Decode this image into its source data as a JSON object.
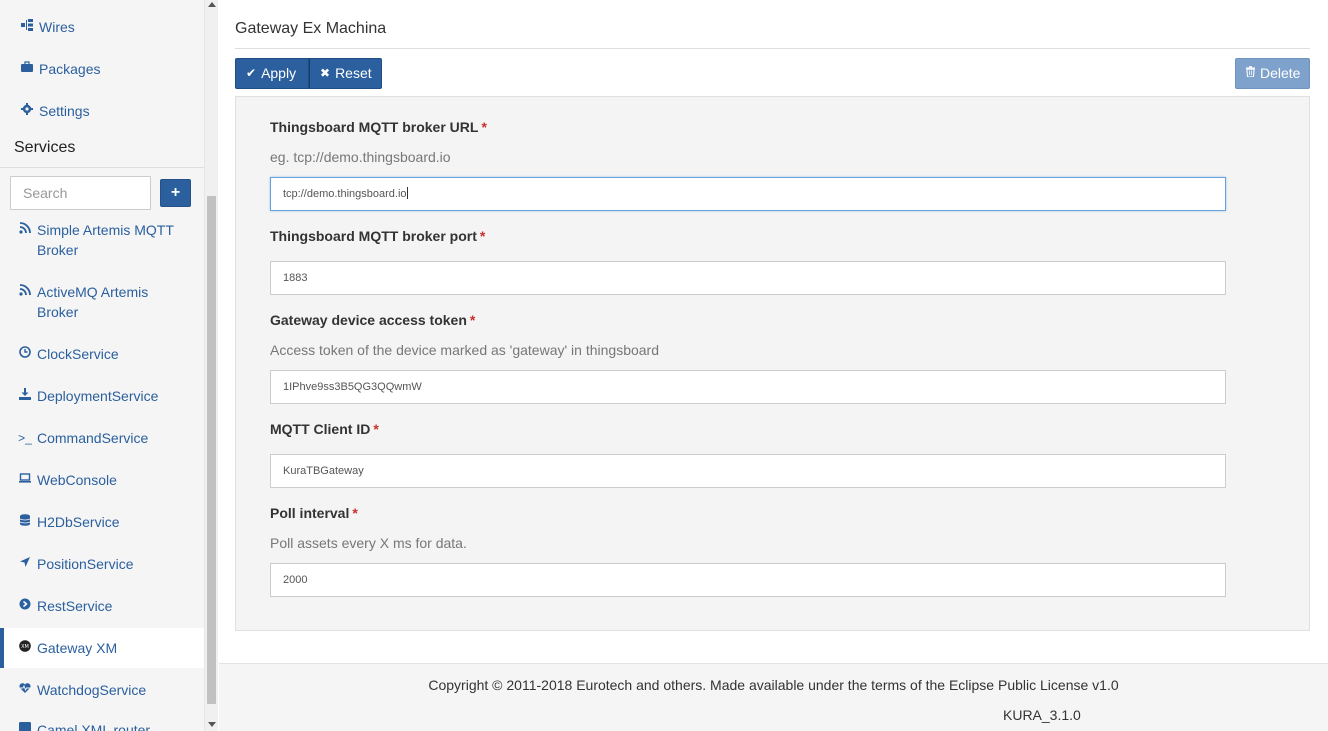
{
  "sidebar": {
    "top_items": [
      {
        "label": "Wires",
        "icon": "sitemap-icon"
      },
      {
        "label": "Packages",
        "icon": "briefcase-icon"
      },
      {
        "label": "Settings",
        "icon": "gear-icon"
      }
    ],
    "services_title": "Services",
    "search_placeholder": "Search",
    "add_label": "+",
    "services": [
      {
        "label": "Simple Artemis MQTT Broker",
        "icon": "rss-icon"
      },
      {
        "label": "ActiveMQ Artemis Broker",
        "icon": "rss-icon"
      },
      {
        "label": "ClockService",
        "icon": "clock-icon"
      },
      {
        "label": "DeploymentService",
        "icon": "download-icon"
      },
      {
        "label": "CommandService",
        "icon": "terminal-icon"
      },
      {
        "label": "WebConsole",
        "icon": "laptop-icon"
      },
      {
        "label": "H2DbService",
        "icon": "database-icon"
      },
      {
        "label": "PositionService",
        "icon": "location-arrow-icon"
      },
      {
        "label": "RestService",
        "icon": "arrow-circle-icon"
      },
      {
        "label": "Gateway XM",
        "icon": "gateway-xm-icon",
        "active": true
      },
      {
        "label": "WatchdogService",
        "icon": "heartbeat-icon"
      },
      {
        "label": "Camel XML router",
        "icon": "camel-icon"
      }
    ]
  },
  "main": {
    "title": "Gateway Ex Machina",
    "toolbar": {
      "apply_label": "Apply",
      "reset_label": "Reset",
      "delete_label": "Delete"
    },
    "fields": [
      {
        "label": "Thingsboard MQTT broker URL",
        "required": "*",
        "help": "eg. tcp://demo.thingsboard.io",
        "value": "tcp://demo.thingsboard.io"
      },
      {
        "label": "Thingsboard MQTT broker port",
        "required": "*",
        "help": "",
        "value": "1883"
      },
      {
        "label": "Gateway device access token",
        "required": "*",
        "help": "Access token of the device marked as 'gateway' in thingsboard",
        "value": "1IPhve9ss3B5QG3QQwmW"
      },
      {
        "label": "MQTT Client ID",
        "required": "*",
        "help": "",
        "value": "KuraTBGateway"
      },
      {
        "label": "Poll interval",
        "required": "*",
        "help": "Poll assets every X ms for data.",
        "value": "2000"
      }
    ]
  },
  "footer": {
    "copyright": "Copyright © 2011-2018 Eurotech and others. Made available under the terms of the Eclipse Public License v1.0",
    "version": "KURA_3.1.0"
  },
  "colors": {
    "accent": "#2b5f9e",
    "delete_disabled": "#7ea2cc",
    "required": "#c9302c"
  }
}
